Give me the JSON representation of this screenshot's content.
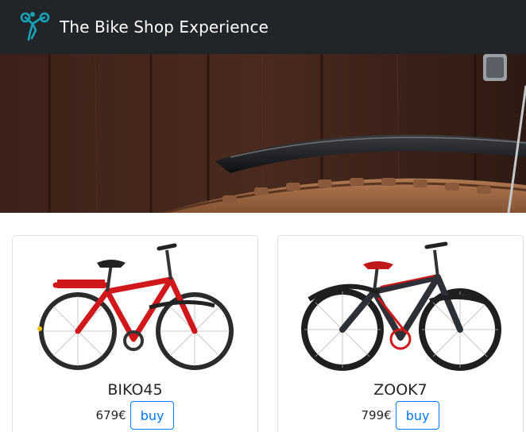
{
  "header": {
    "title": "The Bike Shop Experience",
    "logo_icon": "cyclist-logo-icon",
    "background": "#212529",
    "logo_color": "#17a2b8"
  },
  "hero": {
    "image": "bike-fender-tire-photo"
  },
  "products": [
    {
      "name": "BIKO45",
      "price": "679€",
      "buy_label": "buy",
      "frame_color": "#d0171a"
    },
    {
      "name": "ZOOK7",
      "price": "799€",
      "buy_label": "buy",
      "frame_color": "#2d3036"
    }
  ],
  "accent_color": "#007bff"
}
